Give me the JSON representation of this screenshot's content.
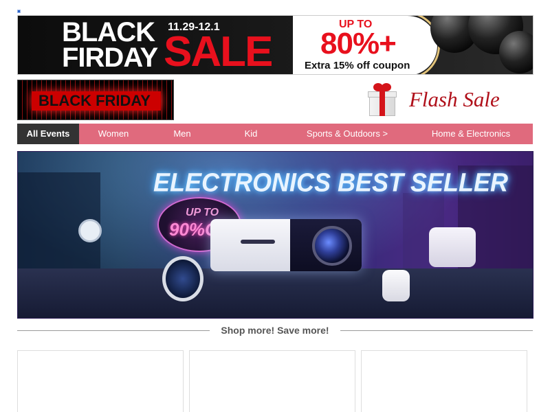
{
  "banner": {
    "black_friday": "BLACK\nFIRDAY",
    "dates": "11.29-12.1",
    "sale": "SALE",
    "up_to": "UP TO",
    "percent": "80%+",
    "coupon": "Extra 15% off coupon"
  },
  "logo": {
    "text": "BLACK FRIDAY"
  },
  "flash_sale": {
    "label": "Flash Sale",
    "icon": "gift-icon"
  },
  "nav": {
    "items": [
      {
        "label": "All Events",
        "active": true
      },
      {
        "label": "Women"
      },
      {
        "label": "Men"
      },
      {
        "label": "Kid"
      },
      {
        "label": "Sports & Outdoors >"
      },
      {
        "label": "Home & Electronics"
      }
    ]
  },
  "hero": {
    "title": "ELECTRONICS BEST SELLER",
    "badge_up_to": "UP TO",
    "badge_off": "90%OFF"
  },
  "section": {
    "shop_more": "Shop more! Save more!"
  },
  "colors": {
    "nav_bg": "#e06a7d",
    "nav_active": "#333333",
    "sale_red": "#e8101d",
    "flash_red": "#b0101a"
  }
}
